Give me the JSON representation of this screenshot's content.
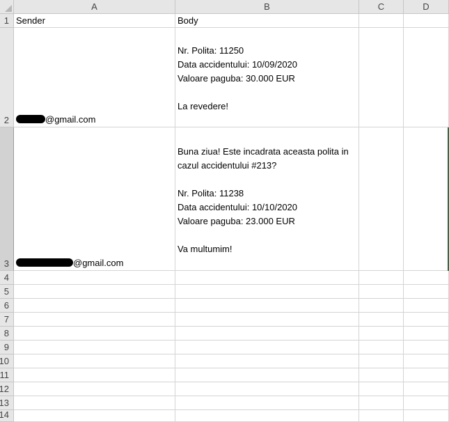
{
  "columns": [
    "A",
    "B",
    "C",
    "D"
  ],
  "rows": [
    "1",
    "2",
    "3",
    "4",
    "5",
    "6",
    "7",
    "8",
    "9",
    "10",
    "11",
    "12",
    "13",
    "14"
  ],
  "cells": {
    "A1": "Sender",
    "B1": "Body",
    "A2_suffix": "@gmail.com",
    "A3_suffix": "@gmail.com",
    "B2": "\nNr. Polita: 11250\nData accidentului: 10/09/2020\nValoare paguba: 30.000 EUR\n\nLa revedere!",
    "B3": "Buna ziua! Este incadrata aceasta polita in\ncazul accidentului #213?\n\nNr. Polita: 11238\nData accidentului: 10/10/2020\nValoare paguba: 23.000 EUR\n\nVa multumim!"
  },
  "colors": {
    "selection": "#217346",
    "header_bg": "#e6e6e6",
    "gridline": "#d4d4d4"
  }
}
